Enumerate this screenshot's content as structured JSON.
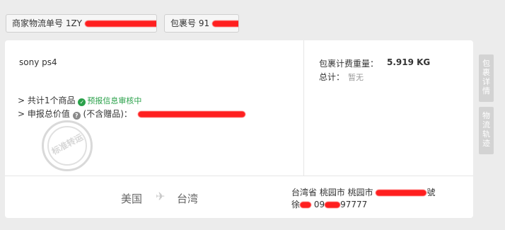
{
  "tags": {
    "tracking_label": "商家物流单号 1ZY",
    "package_label": "包裹号 91"
  },
  "product": {
    "name": "sony ps4",
    "items_summary": "> 共计1个商品",
    "review_status": "预报信息审核中",
    "declared_label": "> 申报总价值",
    "declared_suffix": "(不含赠品)："
  },
  "stamp": {
    "text": "标准转运"
  },
  "weight": {
    "label": "包裹计费重量：",
    "value": "5.919 KG",
    "total_label": "总计：",
    "total_value": "暂无"
  },
  "route": {
    "from": "美国",
    "to": "台湾"
  },
  "address": {
    "line1": "台湾省 桃园市 桃园市",
    "line1_suffix": "號",
    "name_prefix": "徐",
    "phone_prefix": "09",
    "phone_suffix": "97777"
  },
  "side_tabs": {
    "package_details": [
      "包",
      "裹",
      "详",
      "情"
    ],
    "logistics_track": [
      "物",
      "流",
      "轨",
      "迹"
    ]
  },
  "colors": {
    "green": "#2aa14a",
    "redaction": "#ff1f1f",
    "side_tab": "#d3d3d3"
  }
}
